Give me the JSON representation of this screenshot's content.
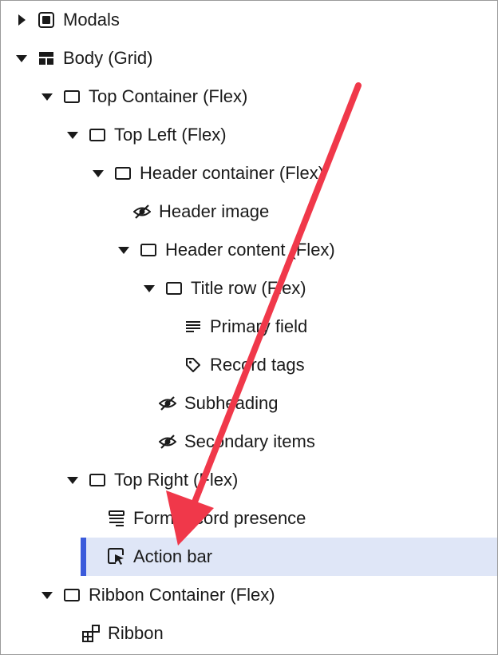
{
  "tree": {
    "items": [
      {
        "label": "Modals",
        "icon": "modal-icon",
        "expanded": false
      },
      {
        "label": "Body (Grid)",
        "icon": "grid-icon",
        "expanded": true
      },
      {
        "label": "Top Container (Flex)",
        "icon": "container-icon",
        "expanded": true
      },
      {
        "label": "Top Left (Flex)",
        "icon": "container-icon",
        "expanded": true
      },
      {
        "label": "Header container (Flex)",
        "icon": "container-icon",
        "expanded": true
      },
      {
        "label": "Header image",
        "icon": "eye-off-icon"
      },
      {
        "label": "Header content (Flex)",
        "icon": "container-icon",
        "expanded": true
      },
      {
        "label": "Title row (Flex)",
        "icon": "container-icon",
        "expanded": true
      },
      {
        "label": "Primary field",
        "icon": "text-lines-icon"
      },
      {
        "label": "Record tags",
        "icon": "tag-icon"
      },
      {
        "label": "Subheading",
        "icon": "eye-off-icon"
      },
      {
        "label": "Secondary items",
        "icon": "eye-off-icon"
      },
      {
        "label": "Top Right (Flex)",
        "icon": "container-icon",
        "expanded": true
      },
      {
        "label": "Form record presence",
        "icon": "stack-icon"
      },
      {
        "label": "Action bar",
        "icon": "cursor-box-icon",
        "selected": true
      },
      {
        "label": "Ribbon Container (Flex)",
        "icon": "container-icon",
        "expanded": true
      },
      {
        "label": "Ribbon",
        "icon": "ribbon-icon"
      }
    ]
  },
  "colors": {
    "selected_bg": "#dfe6f7",
    "selected_bar": "#3b5bdb",
    "annotation_arrow": "#f0384a"
  }
}
